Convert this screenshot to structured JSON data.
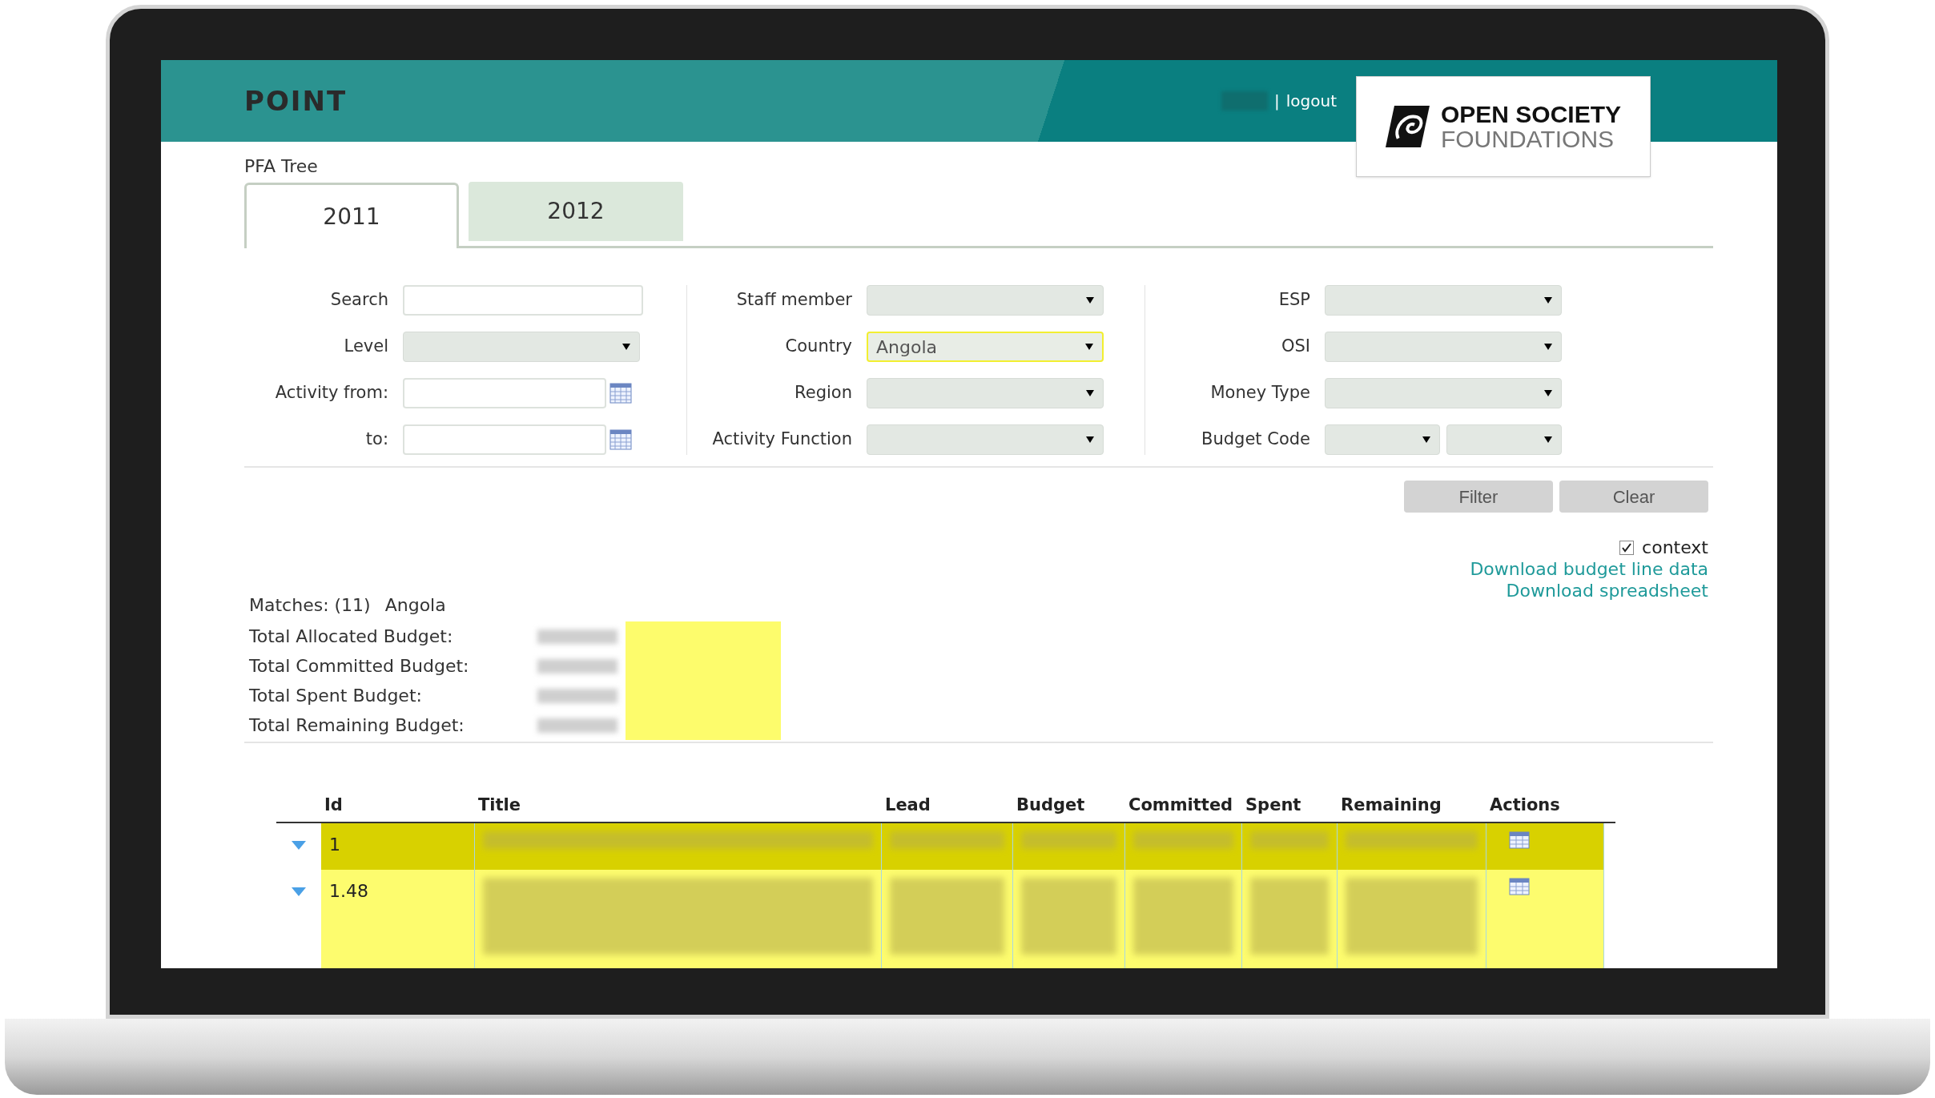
{
  "header": {
    "title": "POINT",
    "separator": "|",
    "logout": "logout",
    "logo": {
      "line1": "OPEN SOCIETY",
      "line2": "FOUNDATIONS"
    }
  },
  "breadcrumb": "PFA Tree",
  "tabs": [
    {
      "label": "2011",
      "selected": true
    },
    {
      "label": "2012",
      "selected": false
    }
  ],
  "filters": [
    [
      {
        "label": "Search",
        "kind": "text"
      },
      {
        "label": "Level",
        "kind": "select"
      },
      {
        "label": "Activity from:",
        "kind": "date"
      },
      {
        "label": "to:",
        "kind": "date"
      }
    ],
    [
      {
        "label": "Staff member",
        "kind": "select"
      },
      {
        "label": "Country",
        "kind": "select",
        "value": "Angola",
        "highlighted": true
      },
      {
        "label": "Region",
        "kind": "select"
      },
      {
        "label": "Activity Function",
        "kind": "select"
      }
    ],
    [
      {
        "label": "ESP",
        "kind": "select"
      },
      {
        "label": "OSI",
        "kind": "select"
      },
      {
        "label": "Money Type",
        "kind": "select"
      },
      {
        "label": "Budget Code",
        "kind": "split"
      }
    ]
  ],
  "buttons": [
    "Filter",
    "Clear"
  ],
  "context": {
    "label": "context",
    "checked": true
  },
  "links": [
    "Download budget line data",
    "Download spreadsheet"
  ],
  "summary": {
    "matches": "Matches: (11)",
    "country": "Angola",
    "totals": [
      "Total Allocated Budget:",
      "Total Committed Budget:",
      "Total Spent Budget:",
      "Total Remaining Budget:"
    ]
  },
  "table": {
    "columns": [
      "Id",
      "Title",
      "Lead",
      "Budget",
      "Committed",
      "Spent",
      "Remaining",
      "Actions"
    ],
    "rows": [
      {
        "id": "1",
        "selected": true,
        "expanded": true
      },
      {
        "id": "1.48",
        "selected": false,
        "expanded": true
      }
    ]
  }
}
